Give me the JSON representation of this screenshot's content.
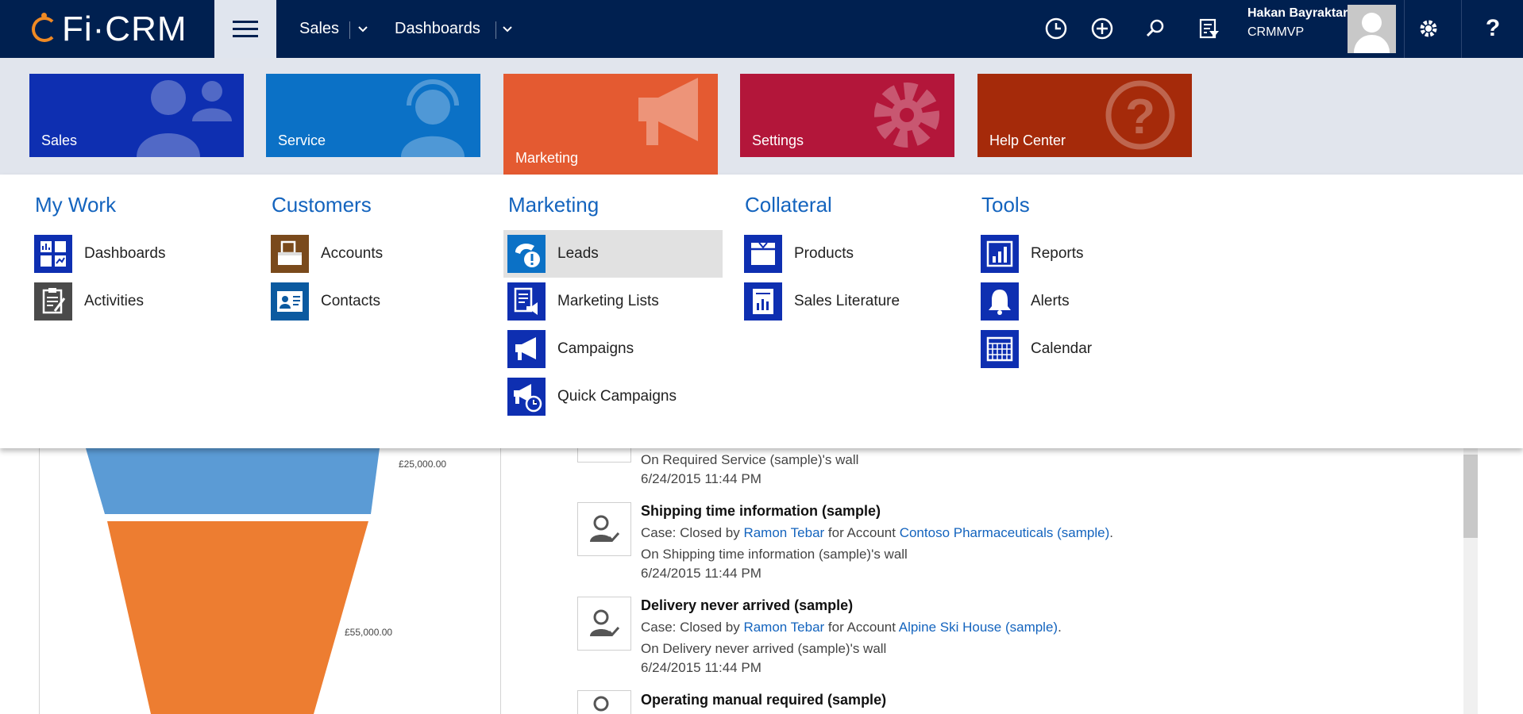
{
  "app": {
    "logo_text": "Fi·CRM"
  },
  "topnav": {
    "items": [
      {
        "label": "Sales"
      },
      {
        "label": "Dashboards"
      }
    ]
  },
  "user": {
    "name": "Hakan Bayraktar",
    "org": "CRMMVP"
  },
  "tiles": [
    {
      "label": "Sales",
      "color": "#0e2fb1"
    },
    {
      "label": "Service",
      "color": "#0b71c6"
    },
    {
      "label": "Marketing",
      "color": "#e45a31"
    },
    {
      "label": "Settings",
      "color": "#b3163a"
    },
    {
      "label": "Help Center",
      "color": "#a52a0a"
    }
  ],
  "menu": {
    "my_work": {
      "heading": "My Work",
      "items": [
        {
          "label": "Dashboards"
        },
        {
          "label": "Activities"
        }
      ]
    },
    "customers": {
      "heading": "Customers",
      "items": [
        {
          "label": "Accounts"
        },
        {
          "label": "Contacts"
        }
      ]
    },
    "marketing": {
      "heading": "Marketing",
      "items": [
        {
          "label": "Leads"
        },
        {
          "label": "Marketing Lists"
        },
        {
          "label": "Campaigns"
        },
        {
          "label": "Quick Campaigns"
        }
      ]
    },
    "collateral": {
      "heading": "Collateral",
      "items": [
        {
          "label": "Products"
        },
        {
          "label": "Sales Literature"
        }
      ]
    },
    "tools": {
      "heading": "Tools",
      "items": [
        {
          "label": "Reports"
        },
        {
          "label": "Alerts"
        },
        {
          "label": "Calendar"
        }
      ]
    }
  },
  "funnel": {
    "labels": [
      "£25,000.00",
      "£55,000.00"
    ],
    "colors": {
      "top": "#5b9bd5",
      "bottom": "#ed7d31"
    }
  },
  "feed": {
    "partial_wall": "On Required Service (sample)'s wall",
    "partial_time": "6/24/2015 11:44 PM",
    "posts": [
      {
        "title": "Shipping time information (sample)",
        "prefix": "Case: Closed by ",
        "user": "Ramon Tebar",
        "mid": " for Account ",
        "account": "Contoso Pharmaceuticals (sample)",
        "suffix": ".",
        "wall": "On Shipping time information (sample)'s wall",
        "time": "6/24/2015 11:44 PM"
      },
      {
        "title": "Delivery never arrived (sample)",
        "prefix": "Case: Closed by ",
        "user": "Ramon Tebar",
        "mid": " for Account ",
        "account": "Alpine Ski House (sample)",
        "suffix": ".",
        "wall": "On Delivery never arrived (sample)'s wall",
        "time": "6/24/2015 11:44 PM"
      },
      {
        "title": "Operating manual required (sample)"
      }
    ]
  }
}
